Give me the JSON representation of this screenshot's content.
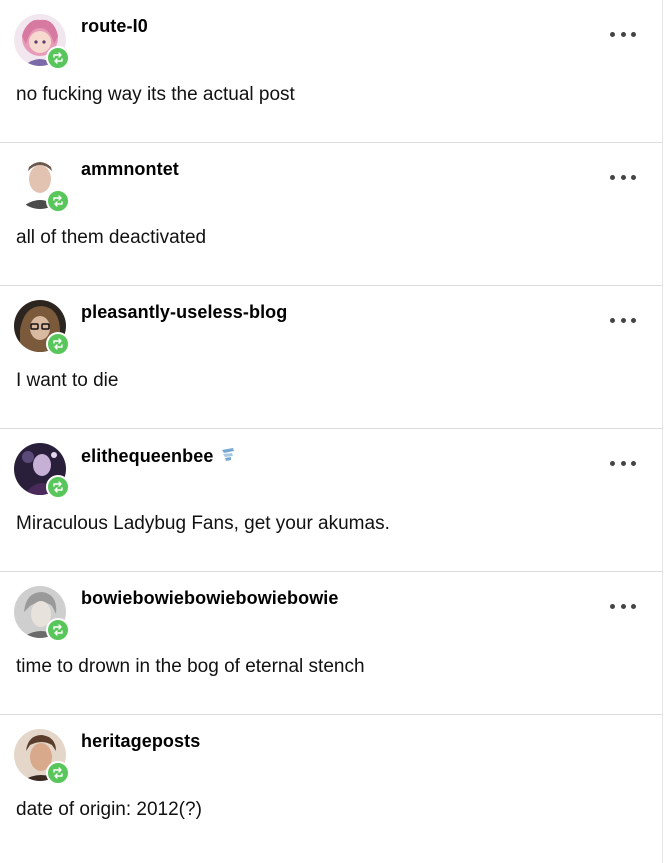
{
  "notes": [
    {
      "username": "route-I0",
      "text": "no fucking way its the actual post",
      "badge": false,
      "menu": true,
      "avatar": "avatar-pink-hair"
    },
    {
      "username": "ammnontet",
      "text": "all of them deactivated",
      "badge": false,
      "menu": true,
      "avatar": "avatar-man-portrait"
    },
    {
      "username": "pleasantly-useless-blog",
      "text": "I want to die",
      "badge": false,
      "menu": true,
      "avatar": "avatar-glasses"
    },
    {
      "username": "elithequeenbee",
      "text": "Miraculous Ladybug Fans, get your akumas.",
      "badge": true,
      "menu": true,
      "avatar": "avatar-dark-figure"
    },
    {
      "username": "bowiebowiebowiebowiebowie",
      "text": "time to drown in the bog of eternal stench",
      "badge": false,
      "menu": true,
      "avatar": "avatar-bowie"
    },
    {
      "username": "heritageposts",
      "text": "date of origin: 2012(?)",
      "badge": false,
      "menu": false,
      "avatar": "avatar-man-portrait-2"
    }
  ],
  "colors": {
    "reblog_badge": "#58c65a",
    "divider": "#dcdcdc",
    "menu_dots": "#444444"
  }
}
